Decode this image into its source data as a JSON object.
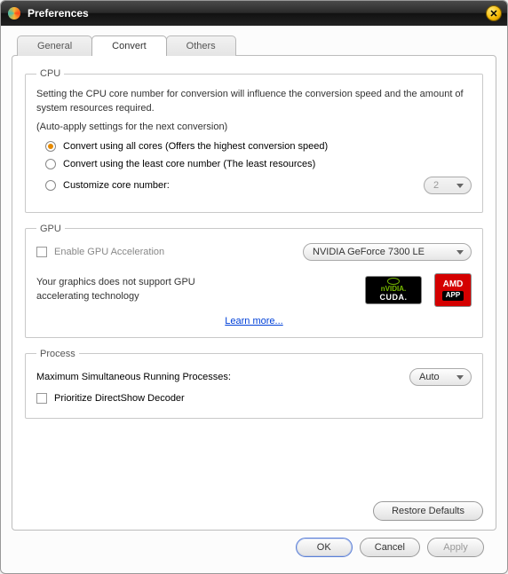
{
  "window": {
    "title": "Preferences"
  },
  "tabs": {
    "general": "General",
    "convert": "Convert",
    "others": "Others"
  },
  "cpu": {
    "legend": "CPU",
    "desc": "Setting the CPU core number for conversion will influence the conversion speed and the amount of system resources required.",
    "auto": "(Auto-apply settings for the next conversion)",
    "opt_all": "Convert using all cores (Offers the highest conversion speed)",
    "opt_least": "Convert using the least core number (The least resources)",
    "opt_custom": "Customize core number:",
    "core_value": "2"
  },
  "gpu": {
    "legend": "GPU",
    "enable": "Enable GPU Acceleration",
    "device": "NVIDIA GeForce 7300 LE",
    "msg": "Your graphics does not support GPU accelerating technology",
    "nvidia_label": "nVIDIA.",
    "nvidia_cuda": "CUDA.",
    "amd_label": "AMD",
    "amd_app": "APP",
    "learn": "Learn more..."
  },
  "process": {
    "legend": "Process",
    "max": "Maximum Simultaneous Running Processes:",
    "auto": "Auto",
    "prioritize": "Prioritize DirectShow Decoder"
  },
  "buttons": {
    "restore": "Restore Defaults",
    "ok": "OK",
    "cancel": "Cancel",
    "apply": "Apply"
  }
}
